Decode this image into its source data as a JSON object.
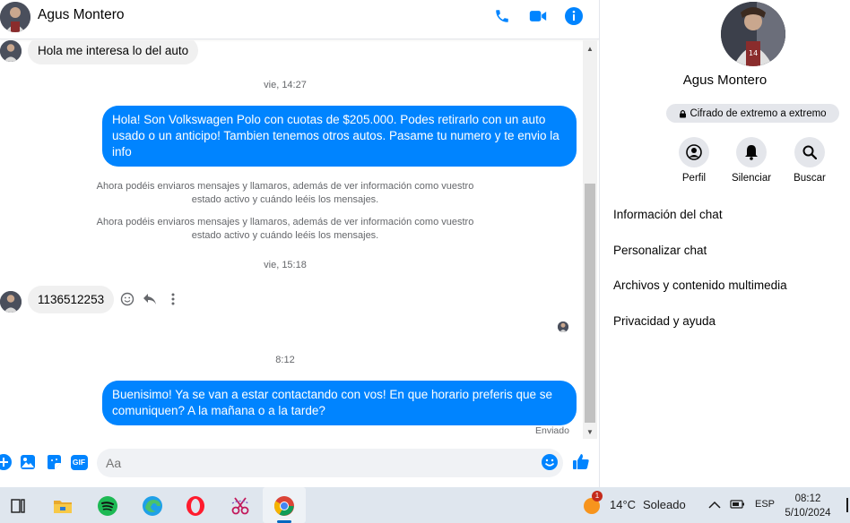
{
  "contact": {
    "name": "Agus Montero"
  },
  "header": {
    "icons": [
      "phone-icon",
      "video-camera-icon",
      "info-icon"
    ]
  },
  "messages": [
    {
      "type": "incoming",
      "text": "Hola me interesa lo del auto"
    },
    {
      "type": "timestamp",
      "text": "vie, 14:27"
    },
    {
      "type": "outgoing",
      "text": "Hola! Son Volkswagen Polo con cuotas de $205.000. Podes retirarlo con un auto usado o un anticipo! Tambien tenemos otros autos. Pasame tu numero y te envio la info"
    },
    {
      "type": "system",
      "text": "Ahora podéis enviaros mensajes y llamaros, además de ver información como vuestro estado activo y cuándo leéis los mensajes."
    },
    {
      "type": "system",
      "text": "Ahora podéis enviaros mensajes y llamaros, además de ver información como vuestro estado activo y cuándo leéis los mensajes."
    },
    {
      "type": "timestamp",
      "text": "vie, 15:18"
    },
    {
      "type": "incoming",
      "text": "1136512253"
    },
    {
      "type": "timestamp",
      "text": "8:12"
    },
    {
      "type": "outgoing",
      "text": "Buenisimo! Ya se van a estar contactando con vos! En que horario preferis que se comuniquen? A la mañana o a la tarde?"
    }
  ],
  "status": "Enviado",
  "composer": {
    "placeholder": "Aa",
    "icons": [
      "plus-icon",
      "photo-icon",
      "sticker-icon",
      "gif-icon",
      "emoji-icon",
      "like-icon"
    ],
    "gif_label": "GIF"
  },
  "info_panel": {
    "name": "Agus Montero",
    "encryption": "Cifrado de extremo a extremo",
    "actions": [
      {
        "label": "Perfil",
        "icon": "profile-icon"
      },
      {
        "label": "Silenciar",
        "icon": "bell-icon"
      },
      {
        "label": "Buscar",
        "icon": "search-icon"
      }
    ],
    "sections": [
      "Información del chat",
      "Personalizar chat",
      "Archivos y contenido multimedia",
      "Privacidad y ayuda"
    ]
  },
  "taskbar": {
    "apps": [
      "task-view-icon",
      "file-explorer-icon",
      "spotify-icon",
      "edge-icon",
      "opera-icon",
      "snipping-tool-icon",
      "chrome-icon"
    ],
    "weather": {
      "temp": "14°C",
      "condition": "Soleado",
      "badge": "1"
    },
    "language": "ESP",
    "time": "08:12",
    "date": "5/10/2024"
  },
  "colors": {
    "accent": "#0084ff",
    "incoming_bubble": "#f0f0f0",
    "taskbar": "#dfe6ee"
  }
}
